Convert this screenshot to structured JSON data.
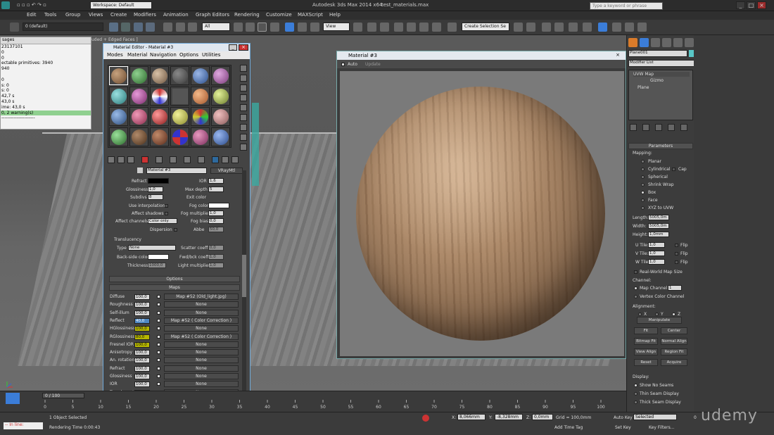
{
  "window": {
    "title": "Autodesk 3ds Max 2014 x64",
    "file": "test_materials.max",
    "workspace": "Workspace: Default",
    "search_placeholder": "Type a keyword or phrase"
  },
  "menu": [
    "Edit",
    "Tools",
    "Group",
    "Views",
    "Create",
    "Modifiers",
    "Animation",
    "Graph Editors",
    "Rendering",
    "Customize",
    "MAXScript",
    "Help"
  ],
  "toolbar": {
    "layer": "0 (default)",
    "filter": "All",
    "view": "View",
    "selection_set": "Create Selection Se"
  },
  "viewport": {
    "label": "uded + Edged Faces ]"
  },
  "messages": {
    "title": "sages",
    "lines": [
      "23137101",
      "0",
      "0",
      "ectable primitives: 3940",
      "940",
      "",
      "0",
      "s: 0",
      "s: 0",
      "42,7 s",
      "43,0 s",
      "ime: 43,0 s",
      "0, 2 warning(s)",
      "----------------------"
    ]
  },
  "mat_editor": {
    "title": "Material Editor - Material #3",
    "menu": [
      "Modes",
      "Material",
      "Navigation",
      "Options",
      "Utilities"
    ],
    "material_name": "Material #3",
    "material_type": "VRayMtl",
    "refract": {
      "label_refract": "Refract",
      "label_ior": "IOR",
      "ior": "1,6",
      "label_glossiness": "Glossiness",
      "glossiness": "1,0",
      "label_max_depth": "Max depth",
      "max_depth": "5",
      "label_subdivs": "Subdivs",
      "subdivs": "8",
      "label_exit_color": "Exit color",
      "label_use_interp": "Use interpolation",
      "label_fog_color": "Fog color",
      "label_affect_shadows": "Affect shadows",
      "label_fog_mult": "Fog multiplier",
      "fog_mult": "1,0",
      "label_affect_channels": "Affect channels",
      "affect_channels": "Color only",
      "label_fog_bias": "Fog bias",
      "fog_bias": "0,0",
      "label_dispersion": "Dispersion",
      "label_abbe": "Abbe",
      "abbe": "50,0"
    },
    "translucency": {
      "title": "Translucency",
      "label_type": "Type",
      "type": "None",
      "label_scatter": "Scatter coeff",
      "scatter": "0,0",
      "label_backside": "Back-side color",
      "label_fwd_bck": "Fwd/bck coeff",
      "fwd_bck": "1,0",
      "label_thickness": "Thickness",
      "thickness": "1000,0",
      "label_light_mult": "Light multiplier",
      "light_mult": "1,0"
    },
    "options_label": "Options",
    "maps_label": "Maps",
    "maps": [
      {
        "name": "Diffuse",
        "amount": "100,0",
        "map": "Map #52 (Old_light.jpg)"
      },
      {
        "name": "Roughness",
        "amount": "100,0",
        "map": "None"
      },
      {
        "name": "Self-illum",
        "amount": "100,0",
        "map": "None"
      },
      {
        "name": "Reflect",
        "amount": "40,0",
        "map": "Map #52  ( Color Correction )"
      },
      {
        "name": "HGlossiness",
        "amount": "100,0",
        "map": "None"
      },
      {
        "name": "RGlossiness",
        "amount": "80,0",
        "map": "Map #52  ( Color Correction )"
      },
      {
        "name": "Fresnel IOR",
        "amount": "100,0",
        "map": "None"
      },
      {
        "name": "Anisotropy",
        "amount": "100,0",
        "map": "None"
      },
      {
        "name": "An. rotation",
        "amount": "100,0",
        "map": "None"
      },
      {
        "name": "Refract",
        "amount": "100,0",
        "map": "None"
      },
      {
        "name": "Glossiness",
        "amount": "100,0",
        "map": "None"
      },
      {
        "name": "IOR",
        "amount": "100,0",
        "map": "None"
      },
      {
        "name": "Translucent",
        "amount": "100,0",
        "map": "None"
      }
    ]
  },
  "mat_window": {
    "title": "Material #3",
    "auto": "Auto",
    "update": "Update"
  },
  "command_panel": {
    "object_name": "Plane001",
    "modifier_list": "Modifier List",
    "stack": [
      "UVW Map",
      "Gizmo",
      "Plane"
    ],
    "parameters": "Parameters",
    "mapping": "Mapping:",
    "mapping_types": [
      "Planar",
      "Cylindrical",
      "Spherical",
      "Shrink Wrap",
      "Box",
      "Face",
      "XYZ to UVW"
    ],
    "cap": "Cap",
    "length_label": "Length:",
    "length": "5005,0m",
    "width_label": "Width:",
    "width": "5005,0m",
    "height_label": "Height:",
    "height": "1,0mm",
    "utile_label": "U Tile:",
    "utile": "1,0",
    "vtile_label": "V Tile:",
    "vtile": "1,0",
    "wtile_label": "W Tile:",
    "wtile": "1,0",
    "flip": "Flip",
    "real_world": "Real-World Map Size",
    "channel": "Channel:",
    "map_channel": "Map Channel:",
    "map_channel_val": "1",
    "vertex_color": "Vertex Color Channel",
    "alignment": "Alignment:",
    "ax": "X",
    "ay": "Y",
    "az": "Z",
    "buttons": [
      "Manipulate",
      "Fit",
      "Center",
      "Bitmap Fit",
      "Normal Align",
      "View Align",
      "Region Fit",
      "Reset",
      "Acquire"
    ],
    "display": "Display:",
    "display_opts": [
      "Show No Seams",
      "Thin Seam Display",
      "Thick Seam Display"
    ]
  },
  "timeline": {
    "frame": "0 / 100",
    "ticks": [
      "0",
      "5",
      "10",
      "15",
      "20",
      "25",
      "30",
      "35",
      "40",
      "45",
      "50",
      "55",
      "60",
      "65",
      "70",
      "75",
      "80",
      "85",
      "90",
      "95",
      "100"
    ]
  },
  "status": {
    "script": "-- In line:",
    "selected": "1 Object Selected",
    "render_time": "Rendering Time  0:00:43",
    "x_label": "X:",
    "x": "8,066mm",
    "y_label": "Y:",
    "y": "-8,328mm",
    "z_label": "Z:",
    "z": "0,0mm",
    "grid": "Grid = 100,0mm",
    "add_time_tag": "Add Time Tag",
    "auto_key": "Auto Key",
    "set_key": "Set Key",
    "key_sel": "Selected",
    "key_filters": "Key Filters...",
    "frame": "0"
  },
  "watermark": "udemy"
}
